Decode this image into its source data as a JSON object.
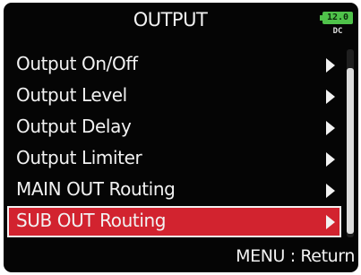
{
  "header": {
    "title": "OUTPUT",
    "battery_level": "12.0",
    "power_source": "DC"
  },
  "menu": {
    "items": [
      {
        "label": "Output On/Off"
      },
      {
        "label": "Output Level"
      },
      {
        "label": "Output Delay"
      },
      {
        "label": "Output Limiter"
      },
      {
        "label": "MAIN OUT Routing"
      },
      {
        "label": "SUB OUT Routing"
      }
    ],
    "selected_label": "SUB OUT Routing"
  },
  "footer": {
    "hint": "MENU : Return"
  },
  "colors": {
    "selection": "#d2232f",
    "battery": "#4fc24a",
    "background": "#050505"
  }
}
